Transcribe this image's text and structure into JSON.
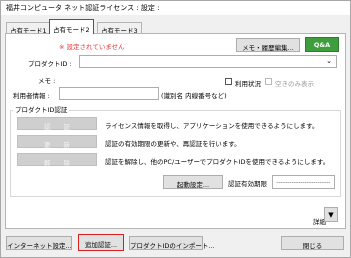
{
  "window": {
    "title": "福井コンピュータ ネット認証ライセンス : 設定 :"
  },
  "tabs": [
    {
      "label": "占有モード1"
    },
    {
      "label": "占有モード2"
    },
    {
      "label": "占有モード3"
    }
  ],
  "warning": "※ 設定されていません",
  "memo_button": "メモ・履歴編集...",
  "qa_button": "Q&A",
  "product_id": {
    "label": "プロダクトID :",
    "value": ""
  },
  "memo": {
    "label": "メモ :"
  },
  "usage_status": "利用状況",
  "free_display": "空きのみ表示",
  "user_info": {
    "label": "利用者情報 :",
    "hint": "(識別名 内線番号など)",
    "value": ""
  },
  "auth_group": {
    "legend": "プロダクトID認証",
    "rows": [
      {
        "button": "認　　証",
        "text": "ライセンス情報を取得し、アプリケーションを使用できるようにします。"
      },
      {
        "button": "更　　新",
        "text": "認証の有効期限の更新や、再認証を行います。"
      },
      {
        "button": "解　　除",
        "text": "認証を解除し、他のPC/ユーザーでプロダクトIDを使用できるようにします。"
      }
    ],
    "startup_button": "起動設定...",
    "expiry_label": "認証有効期限",
    "expiry_value": "-------------------------"
  },
  "details_label": "詳細",
  "details_arrow": "▼",
  "bottom": {
    "internet": "インターネット設定...",
    "add_auth": "追加認証...",
    "import": "プロダクトIDのインポート...",
    "close": "閉じる"
  },
  "colors": {
    "accent_red": "#d42020",
    "qa_green": "#3e9e3e",
    "warning_red": "#e23a3a"
  }
}
